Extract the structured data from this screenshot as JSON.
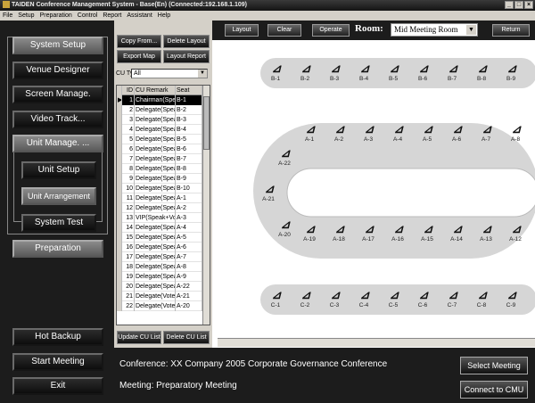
{
  "window": {
    "title": "TAIDEN Conference Management System - Base(En) (Connected:192.168.1.109)"
  },
  "menu": [
    "File",
    "Setup",
    "Preparation",
    "Control",
    "Report",
    "Assistant",
    "Help"
  ],
  "left_nav": {
    "system_setup": "System Setup",
    "venue_designer": "Venue Designer",
    "screen_manage": "Screen Manage.",
    "video_track": "Video Track...",
    "unit_manage": "Unit Manage. ...",
    "unit_setup": "Unit Setup",
    "unit_arrangement": "Unit Arrangement",
    "system_test": "System Test",
    "preparation": "Preparation",
    "hot_backup": "Hot Backup",
    "start_meeting": "Start Meeting",
    "exit": "Exit"
  },
  "cu_panel": {
    "copy_from": "Copy From...",
    "delete_layout": "Delete Layout",
    "export_map": "Export Map",
    "layout_report": "Layout Report",
    "cu_type_label": "CU Type",
    "cu_type_value": "All",
    "update_cu_list": "Update CU List",
    "delete_cu_list": "Delete CU List",
    "columns": [
      "ID",
      "CU Remark",
      "Seat"
    ],
    "rows": [
      {
        "id": "1",
        "remark": "Chairman(Speak",
        "seat": "B-1"
      },
      {
        "id": "2",
        "remark": "Delegate(Speak",
        "seat": "B-2"
      },
      {
        "id": "3",
        "remark": "Delegate(Speak",
        "seat": "B-3"
      },
      {
        "id": "4",
        "remark": "Delegate(Speak",
        "seat": "B-4"
      },
      {
        "id": "5",
        "remark": "Delegate(Speak",
        "seat": "B-5"
      },
      {
        "id": "6",
        "remark": "Delegate(Speak",
        "seat": "B-6"
      },
      {
        "id": "7",
        "remark": "Delegate(Speak",
        "seat": "B-7"
      },
      {
        "id": "8",
        "remark": "Delegate(Speak",
        "seat": "B-8"
      },
      {
        "id": "9",
        "remark": "Delegate(Speak",
        "seat": "B-9"
      },
      {
        "id": "10",
        "remark": "Delegate(Speak",
        "seat": "B-10"
      },
      {
        "id": "11",
        "remark": "Delegate(Speak",
        "seat": "A-1"
      },
      {
        "id": "12",
        "remark": "Delegate(Speak",
        "seat": "A-2"
      },
      {
        "id": "13",
        "remark": "VIP(Speak+Vote",
        "seat": "A-3"
      },
      {
        "id": "14",
        "remark": "Delegate(Speak",
        "seat": "A-4"
      },
      {
        "id": "15",
        "remark": "Delegate(Speak",
        "seat": "A-5"
      },
      {
        "id": "16",
        "remark": "Delegate(Speak",
        "seat": "A-6"
      },
      {
        "id": "17",
        "remark": "Delegate(Speak",
        "seat": "A-7"
      },
      {
        "id": "18",
        "remark": "Delegate(Speak",
        "seat": "A-8"
      },
      {
        "id": "19",
        "remark": "Delegate(Speak",
        "seat": "A-9"
      },
      {
        "id": "20",
        "remark": "Delegate(Speak",
        "seat": "A-22"
      },
      {
        "id": "21",
        "remark": "Delegate(Vote)",
        "seat": "A-21"
      },
      {
        "id": "22",
        "remark": "Delegate(Vote)",
        "seat": "A-20"
      }
    ]
  },
  "toolbar": {
    "layout": "Layout",
    "clear": "Clear",
    "operate": "Operate",
    "room_label": "Room:",
    "room_value": "Mid Meeting Room",
    "return": "Return"
  },
  "seats": {
    "row_b": [
      "B-1",
      "B-2",
      "B-3",
      "B-4",
      "B-5",
      "B-6",
      "B-7",
      "B-8",
      "B-9"
    ],
    "row_a_top": [
      "A-1",
      "A-2",
      "A-3",
      "A-4",
      "A-5",
      "A-6",
      "A-7",
      "A-8"
    ],
    "row_a_left": [
      "A-22",
      "A-21",
      "A-20"
    ],
    "row_a_bottom": [
      "A-19",
      "A-18",
      "A-17",
      "A-16",
      "A-15",
      "A-14",
      "A-13",
      "A-12"
    ],
    "row_c": [
      "C-1",
      "C-2",
      "C-3",
      "C-4",
      "C-5",
      "C-6",
      "C-7",
      "C-8",
      "C-9"
    ]
  },
  "footer": {
    "conference": "Conference: XX Company 2005 Corporate Governance Conference",
    "meeting": "Meeting: Preparatory Meeting",
    "select_meeting": "Select Meeting",
    "connect_cmu": "Connect to CMU"
  }
}
